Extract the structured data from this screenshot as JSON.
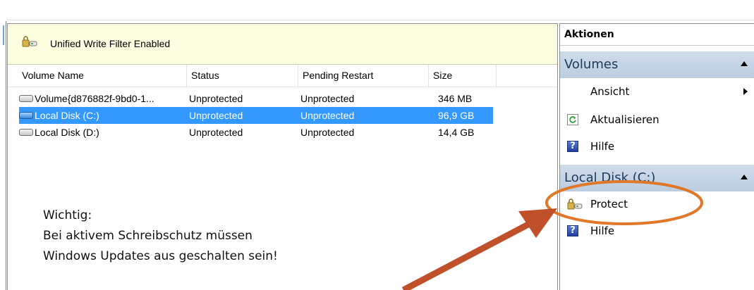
{
  "banner": {
    "text": "Unified Write Filter Enabled",
    "icon": "lock-icon"
  },
  "table": {
    "columns": [
      "Volume Name",
      "Status",
      "Pending Restart",
      "Size"
    ],
    "rows": [
      {
        "name": "Volume{d876882f-9bd0-1...",
        "status": "Unprotected",
        "pending": "Unprotected",
        "size": "346 MB",
        "selected": false
      },
      {
        "name": "Local Disk (C:)",
        "status": "Unprotected",
        "pending": "Unprotected",
        "size": "96,9 GB",
        "selected": true
      },
      {
        "name": "Local Disk (D:)",
        "status": "Unprotected",
        "pending": "Unprotected",
        "size": "14,4 GB",
        "selected": false
      }
    ]
  },
  "note": {
    "line1": "Wichtig:",
    "line2": "Bei aktivem Schreibschutz müssen",
    "line3": "Windows Updates aus geschalten sein!"
  },
  "actions": {
    "header": "Aktionen",
    "volumes_group": "Volumes",
    "ansicht": "Ansicht",
    "aktualisieren": "Aktualisieren",
    "hilfe1": "Hilfe",
    "disk_group": "Local Disk (C:)",
    "protect": "Protect",
    "hilfe2": "Hilfe"
  },
  "colors": {
    "selection": "#3399ff",
    "banner_bg": "#fdfde0",
    "group_header_bg": "#c5d5e7",
    "annotation": "#e0782a"
  }
}
